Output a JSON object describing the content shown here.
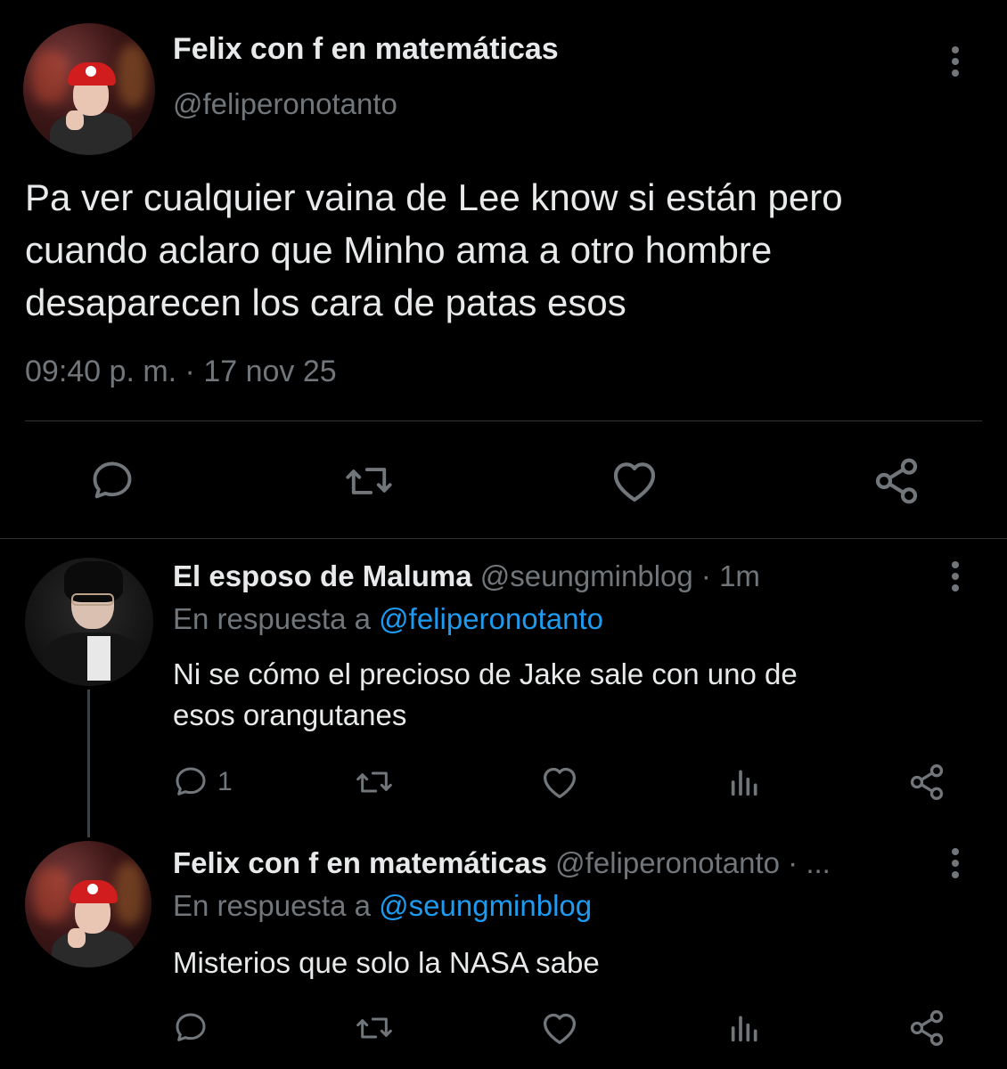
{
  "main_tweet": {
    "display_name": "Felix con f en matemáticas",
    "handle": "@feliperonotanto",
    "text_line1": "Pa ver cualquier vaina de Lee know si están pero",
    "text_line2": "cuando aclaro que Minho ama a otro hombre",
    "text_line3": "desaparecen los cara de patas esos",
    "timestamp": "09:40 p. m. · 17 nov 25"
  },
  "reply1": {
    "display_name": "El esposo de Maluma",
    "meta": "@seungminblog · 1m",
    "replying_prefix": "En respuesta a",
    "replying_to": "@feliperonotanto",
    "text_line1": "Ni se cómo el precioso de Jake sale con uno de",
    "text_line2": "esos orangutanes",
    "reply_count": "1"
  },
  "reply2": {
    "display_name": "Felix con f en matemáticas",
    "meta": "@feliperonotanto · ...",
    "replying_prefix": "En respuesta a",
    "replying_to": "@seungminblog",
    "text_line1": "Misterios que solo la NASA sabe"
  },
  "icons": {
    "more": "more-vertical-icon",
    "reply": "reply-icon",
    "retweet": "retweet-icon",
    "like": "heart-icon",
    "views": "views-icon",
    "share": "share-icon"
  },
  "colors": {
    "background": "#000000",
    "text": "#e7e9ea",
    "muted": "#71767b",
    "link": "#1d9bf0"
  }
}
